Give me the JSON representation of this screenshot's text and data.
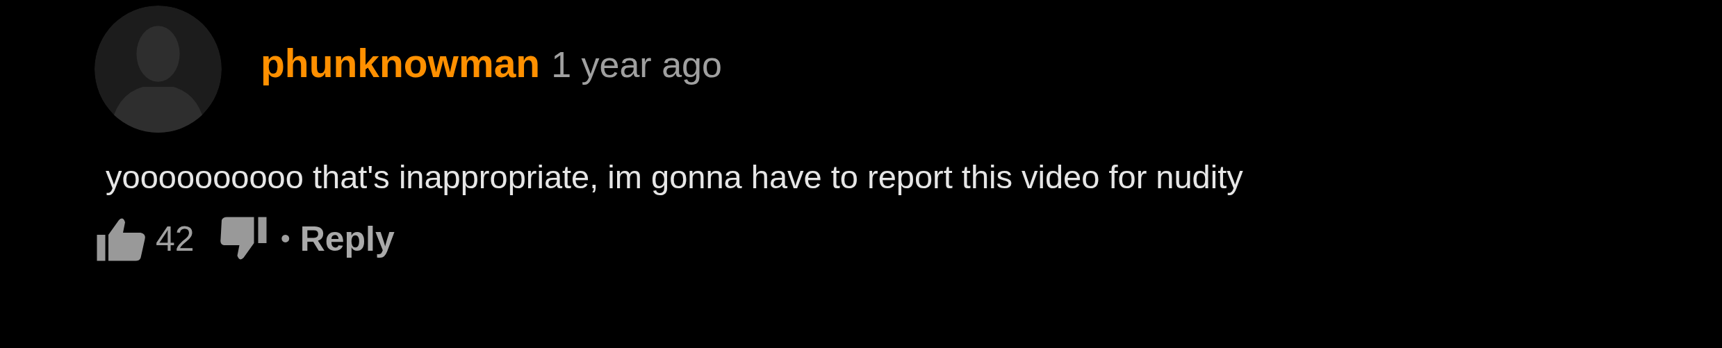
{
  "comment": {
    "username": "phunknowman",
    "time": "1 year ago",
    "text": "yoooooooooo that's inappropriate, im gonna have to report this video for nudity",
    "likes": "42",
    "separator": "•",
    "reply": "Reply"
  }
}
